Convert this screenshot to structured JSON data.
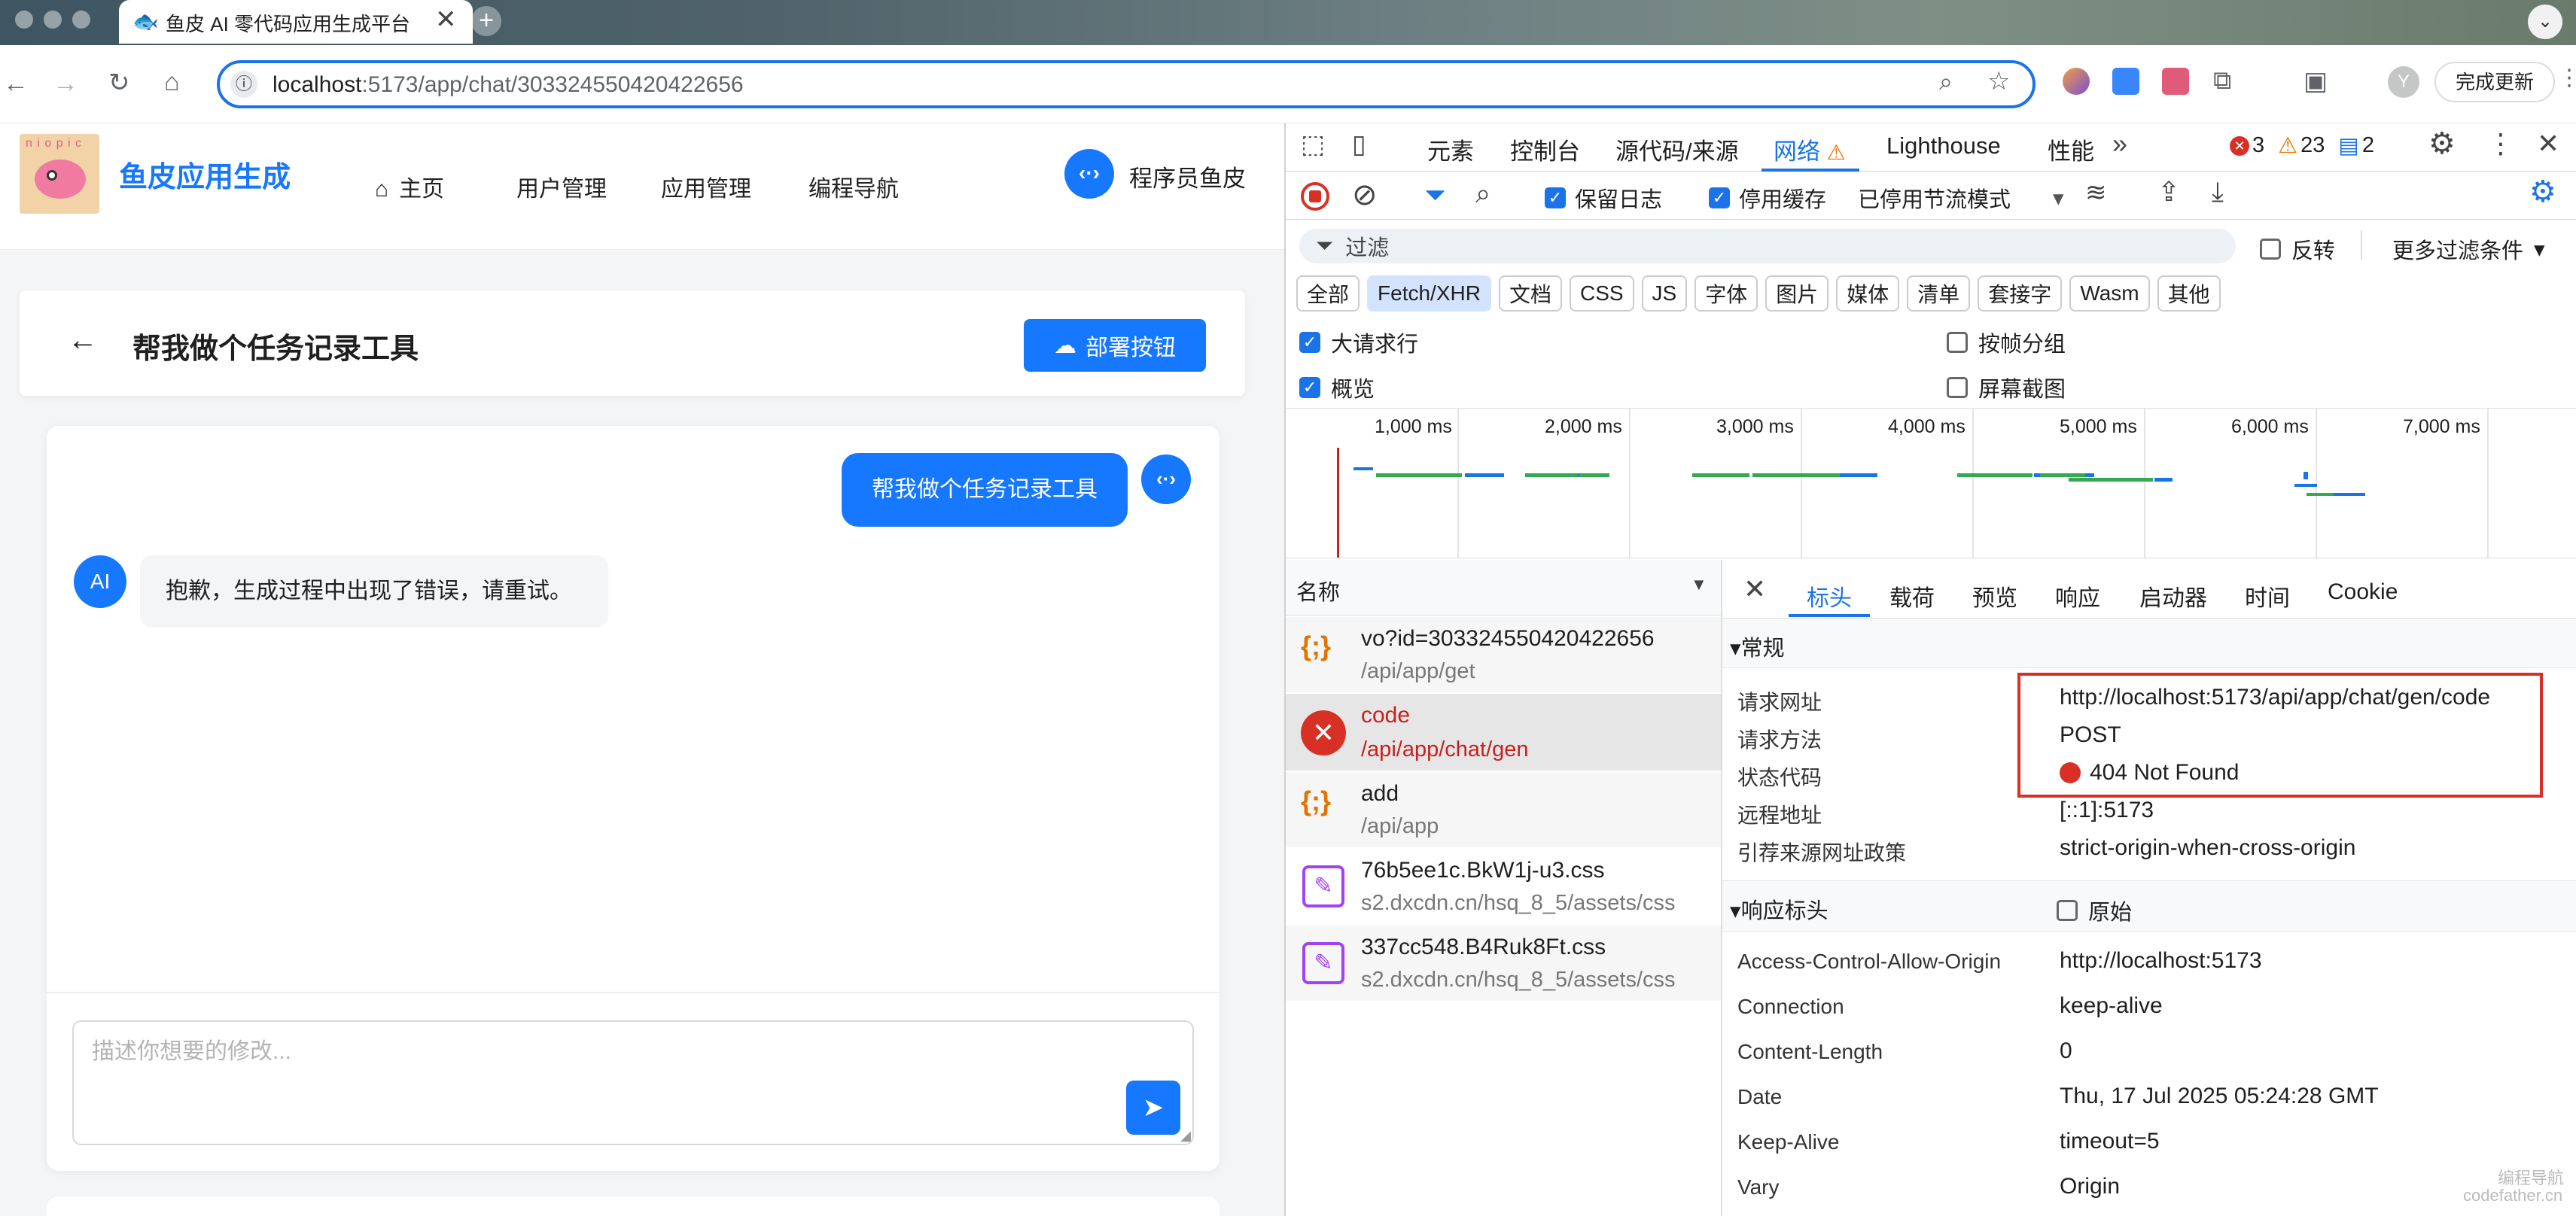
{
  "browser": {
    "tab_title": "鱼皮 AI 零代码应用生成平台",
    "url_host": "localhost",
    "url_rest": ":5173/app/chat/303324550420422656",
    "finish_update": "完成更新",
    "profile_initial": "Y"
  },
  "site": {
    "brand": "鱼皮应用生成",
    "logo_text": "n i o p i c",
    "nav": [
      "主页",
      "用户管理",
      "应用管理",
      "编程导航"
    ],
    "user_name": "程序员鱼皮",
    "page_title": "帮我做个任务记录工具",
    "deploy_label": "部署按钮",
    "user_message": "帮我做个任务记录工具",
    "ai_avatar": "AI",
    "ai_message": "抱歉，生成过程中出现了错误，请重试。",
    "input_placeholder": "描述你想要的修改..."
  },
  "devtools": {
    "tabs": [
      "元素",
      "控制台",
      "源代码/来源",
      "网络",
      "Lighthouse",
      "性能"
    ],
    "active_tab": "网络",
    "errors": "3",
    "warnings": "23",
    "messages": "2",
    "preserve_log": "保留日志",
    "disable_cache": "停用缓存",
    "throttle": "已停用节流模式",
    "filter_placeholder": "过滤",
    "invert": "反转",
    "more_filters": "更多过滤条件",
    "type_filters": [
      "全部",
      "Fetch/XHR",
      "文档",
      "CSS",
      "JS",
      "字体",
      "图片",
      "媒体",
      "清单",
      "套接字",
      "Wasm",
      "其他"
    ],
    "active_filter": "Fetch/XHR",
    "big_rows": "大请求行",
    "group_by_frame": "按帧分组",
    "overview": "概览",
    "screenshots": "屏幕截图",
    "timeline_ticks": [
      "1,000 ms",
      "2,000 ms",
      "3,000 ms",
      "4,000 ms",
      "5,000 ms",
      "6,000 ms",
      "7,000 ms"
    ],
    "name_header": "名称",
    "requests": [
      {
        "name": "vo?id=303324550420422656",
        "path": "/api/app/get",
        "type": "fetch",
        "error": false
      },
      {
        "name": "code",
        "path": "/api/app/chat/gen",
        "type": "error",
        "error": true
      },
      {
        "name": "add",
        "path": "/api/app",
        "type": "fetch",
        "error": false
      },
      {
        "name": "76b5ee1c.BkW1j-u3.css",
        "path": "s2.dxcdn.cn/hsq_8_5/assets/css",
        "type": "css",
        "error": false
      },
      {
        "name": "337cc548.B4Ruk8Ft.css",
        "path": "s2.dxcdn.cn/hsq_8_5/assets/css",
        "type": "css",
        "error": false
      }
    ],
    "detail_tabs": [
      "标头",
      "载荷",
      "预览",
      "响应",
      "启动器",
      "时间",
      "Cookie"
    ],
    "active_detail_tab": "标头",
    "general_title": "常规",
    "general": [
      {
        "k": "请求网址",
        "v": "http://localhost:5173/api/app/chat/gen/code"
      },
      {
        "k": "请求方法",
        "v": "POST"
      },
      {
        "k": "状态代码",
        "v": "404 Not Found"
      },
      {
        "k": "远程地址",
        "v": "[::1]:5173"
      },
      {
        "k": "引荐来源网址政策",
        "v": "strict-origin-when-cross-origin"
      }
    ],
    "response_headers_title": "响应标头",
    "raw": "原始",
    "response_headers": [
      {
        "k": "Access-Control-Allow-Origin",
        "v": "http://localhost:5173"
      },
      {
        "k": "Connection",
        "v": "keep-alive"
      },
      {
        "k": "Content-Length",
        "v": "0"
      },
      {
        "k": "Date",
        "v": "Thu, 17 Jul 2025 05:24:28 GMT"
      },
      {
        "k": "Keep-Alive",
        "v": "timeout=5"
      },
      {
        "k": "Vary",
        "v": "Origin"
      }
    ]
  },
  "watermark": {
    "line1": "编程导航",
    "line2": "codefather.cn"
  },
  "colors": {
    "accent": "#1677ff",
    "devtools_blue": "#1a73e8",
    "error": "#d93025",
    "highlight_box": "#d93025"
  }
}
